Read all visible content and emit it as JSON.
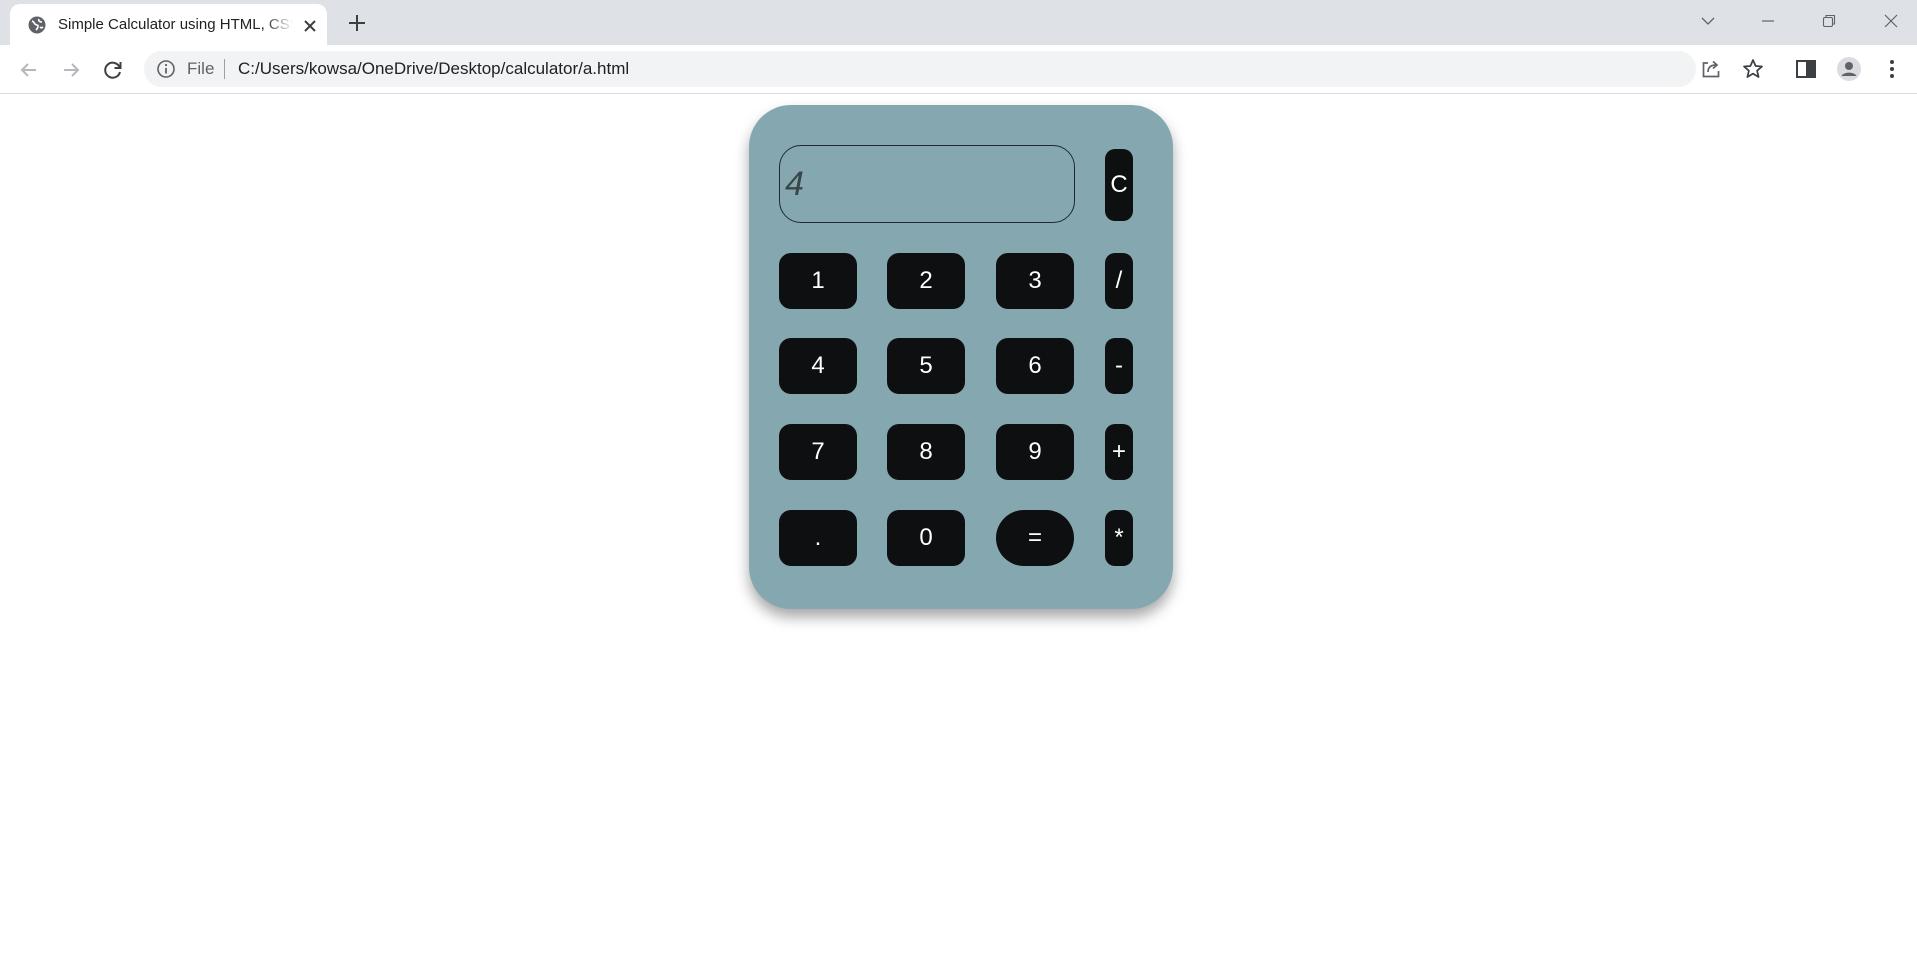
{
  "browser": {
    "tab": {
      "title": "Simple Calculator using HTML, CSS and JavaScript"
    },
    "address_bar": {
      "scheme_label": "File",
      "url": "C:/Users/kowsa/OneDrive/Desktop/calculator/a.html"
    },
    "icons": {
      "favicon": "globe-icon",
      "tab_close": "close-icon",
      "new_tab": "plus-icon",
      "tab_search": "chevron-down-icon",
      "minimize": "minimize-icon",
      "restore": "restore-icon",
      "close_window": "close-icon",
      "back": "back-arrow-icon",
      "forward": "forward-arrow-icon",
      "reload": "reload-icon",
      "site_info": "info-icon",
      "share": "share-icon",
      "bookmark": "star-icon",
      "side_panel": "side-panel-icon",
      "profile": "profile-icon",
      "menu": "more-vert-icon"
    }
  },
  "calculator": {
    "display_value": "4",
    "clear_label": "C",
    "keys": {
      "one": "1",
      "two": "2",
      "three": "3",
      "divide": "/",
      "four": "4",
      "five": "5",
      "six": "6",
      "subtract": "-",
      "seven": "7",
      "eight": "8",
      "nine": "9",
      "add": "+",
      "decimal": ".",
      "zero": "0",
      "equals": "=",
      "multiply": "*"
    },
    "colors": {
      "body": "#85a8b0",
      "key": "#0d0f10",
      "key_text": "#ffffff"
    }
  }
}
